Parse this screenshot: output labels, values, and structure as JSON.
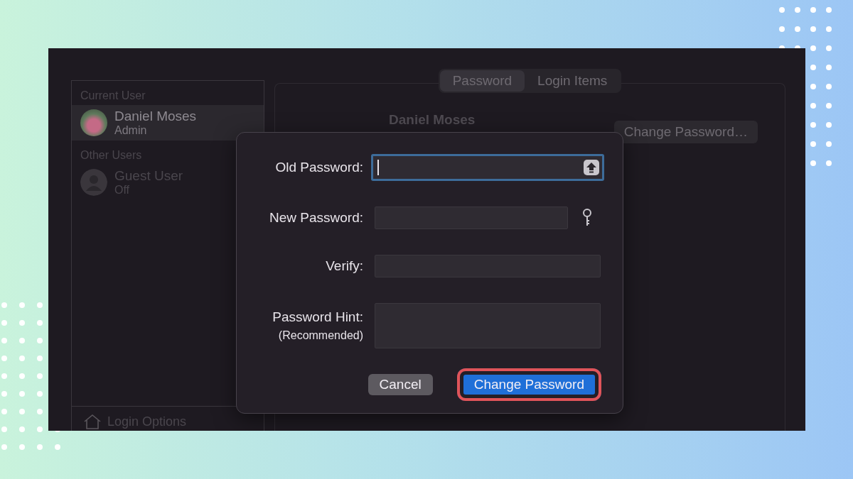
{
  "sidebar": {
    "sections": [
      {
        "heading": "Current User",
        "users": [
          {
            "name": "Daniel Moses",
            "role": "Admin",
            "selected": true,
            "kind": "photo"
          }
        ]
      },
      {
        "heading": "Other Users",
        "users": [
          {
            "name": "Guest User",
            "role": "Off",
            "selected": false,
            "kind": "silhouette"
          }
        ]
      }
    ],
    "footer": "Login Options"
  },
  "tabs": [
    {
      "label": "Password",
      "selected": true
    },
    {
      "label": "Login Items",
      "selected": false
    }
  ],
  "account": {
    "name": "Daniel Moses",
    "button": "Change Password…"
  },
  "dialog": {
    "fields": [
      {
        "label": "Old Password:",
        "kind": "capslock",
        "focused": true
      },
      {
        "label": "New Password:",
        "kind": "key",
        "focused": false
      },
      {
        "label": "Verify:",
        "kind": "plain",
        "focused": false
      },
      {
        "label": "Password Hint:",
        "sublabel": "(Recommended)",
        "kind": "hint",
        "focused": false
      }
    ],
    "buttons": [
      {
        "label": "Cancel",
        "kind": "secondary",
        "highlighted": false
      },
      {
        "label": "Change Password",
        "kind": "primary",
        "highlighted": true
      }
    ]
  }
}
